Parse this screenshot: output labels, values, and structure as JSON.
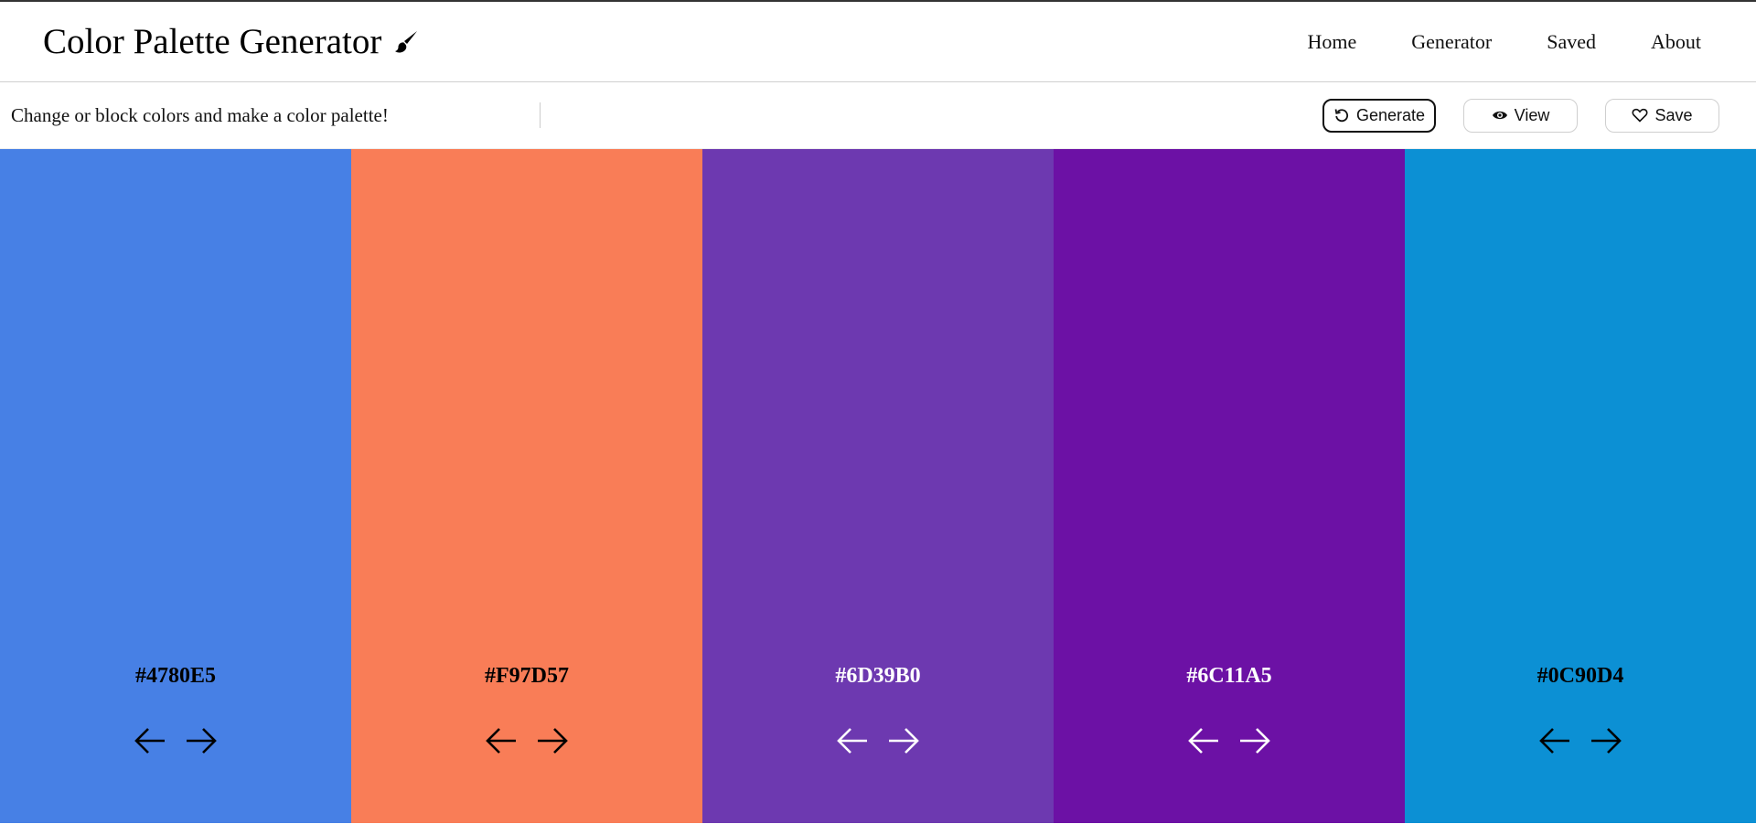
{
  "app": {
    "title": "Color Palette Generator",
    "brand_icon": "paintbrush-icon"
  },
  "nav": {
    "links": [
      "Home",
      "Generator",
      "Saved",
      "About"
    ]
  },
  "toolbar": {
    "hint": "Change or block colors and make a color palette!",
    "generate_label": "Generate",
    "generate_icon": "rotate-left-icon",
    "view_label": "View",
    "view_icon": "eye-icon",
    "save_label": "Save",
    "save_icon": "heart-outline-icon"
  },
  "palette": [
    {
      "hex": "#4780E5",
      "color": "#4780E5",
      "text_color": "#000000"
    },
    {
      "hex": "#F97D57",
      "color": "#F97D57",
      "text_color": "#000000"
    },
    {
      "hex": "#6D39B0",
      "color": "#6D39B0",
      "text_color": "#ffffff"
    },
    {
      "hex": "#6C11A5",
      "color": "#6C11A5",
      "text_color": "#ffffff"
    },
    {
      "hex": "#0C90D4",
      "color": "#0C90D4",
      "text_color": "#000000"
    }
  ]
}
